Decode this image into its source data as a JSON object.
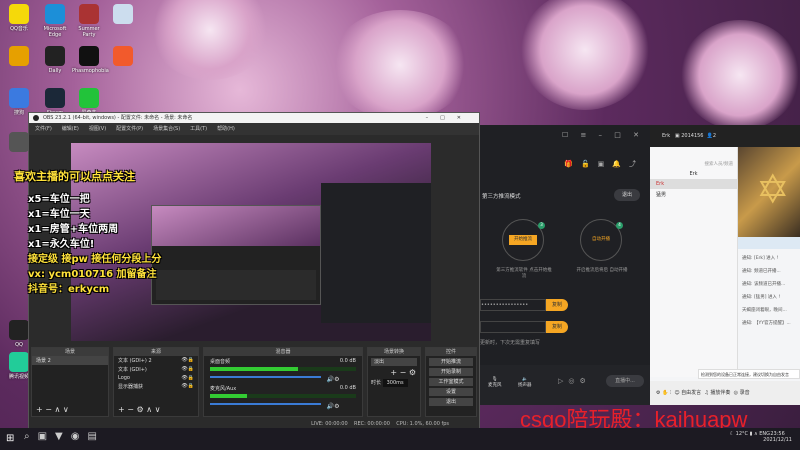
{
  "desktop_icons": [
    {
      "label": "QQ音乐",
      "color": "#f5d90a"
    },
    {
      "label": "Microsoft Edge",
      "color": "#1c8fd8"
    },
    {
      "label": "Summer Party",
      "color": "#a33"
    },
    {
      "label": "",
      "color": "#cde"
    },
    {
      "label": "",
      "color": "#e6a000"
    },
    {
      "label": "Dally",
      "color": "#222"
    },
    {
      "label": "Phasmophobia",
      "color": "#111"
    },
    {
      "label": "",
      "color": "#f25a2c"
    },
    {
      "label": "搜狗",
      "color": "#3b7ae0"
    },
    {
      "label": "Steam",
      "color": "#1b2838"
    },
    {
      "label": "爱奇艺",
      "color": "#22c33a"
    },
    {
      "label": "",
      "color": "#555"
    },
    {
      "label": "QQ",
      "color": "#222"
    },
    {
      "label": "腾讯视频",
      "color": "#2c9"
    }
  ],
  "overlay": {
    "title": "喜欢主播的可以点点关注",
    "lines": [
      "x5=车位一把",
      "x1=车位一天",
      "x1=房管+车位两周",
      "x1=永久车位!",
      "接定级 接pw 接任何分段上分",
      "vx: ycm010716 加留备注",
      "抖音号：erkycm"
    ],
    "watermark": "csgo陪玩殿：kaihuapw"
  },
  "obs": {
    "title": "OBS 23.2.1 (64-bit, windows) - 配置文件: 未命名 - 场景: 未命名",
    "menu": [
      "文件(F)",
      "编辑(E)",
      "视图(V)",
      "配置文件(P)",
      "场景集合(S)",
      "工具(T)",
      "帮助(H)"
    ],
    "docks": {
      "scenes": "场景",
      "sources": "来源",
      "mixer": "混音器",
      "transitions": "场景转换",
      "controls": "控件"
    },
    "scene_items": [
      "场景 2"
    ],
    "source_items": [
      "文本 (GDI+) 2",
      "文本 (GDI+)",
      "Logo",
      "显示器捕获"
    ],
    "mixer": [
      {
        "name": "桌面音频",
        "db": "0.0 dB",
        "level": 0.6
      },
      {
        "name": "麦克风/Aux",
        "db": "0.0 dB",
        "level": 0.25
      }
    ],
    "transition": "淡出",
    "duration_label": "时长",
    "duration": "300ms",
    "controls": [
      "开始推流",
      "开始录制",
      "工作室模式",
      "设置",
      "退出"
    ],
    "status": {
      "live": "LIVE: 00:00:00",
      "rec": "REC: 00:00:00",
      "cpu": "CPU: 1.0%, 60.00 fps"
    }
  },
  "app": {
    "mode": "第三方推流模式",
    "exit": "退出",
    "step3": {
      "btn": "开始推流",
      "desc": "第三方推流软件 点击开始推流"
    },
    "step4": {
      "btn": "自动开播",
      "desc": "开启推流后将后 自动开播"
    },
    "key_mask": "••••••••••••••••",
    "copy": "复制",
    "hint": "更新时，下次无需重复填写",
    "mic": "麦克风",
    "speaker": "扬声器",
    "live": "直播中..."
  },
  "yy": {
    "user": "Erk",
    "room": "2014156",
    "count": "2",
    "search": "搜索人员/频道",
    "channel": "Erk",
    "members": [
      "Erk",
      "猛男"
    ],
    "messages": [
      "通知: [Erk] 进入 !",
      "通知: 频道已开播...",
      "通知: 该频道已开播...",
      "通知: [猛男] 进入 !",
      "天蝎座闭着眼，晚间...",
      "通知: 【YY官方提醒】..."
    ],
    "tip": "检测到您的设备已正常连接，建议切换为自由发言",
    "tools": [
      "自由发言",
      "播放伴奏",
      "录音"
    ]
  },
  "taskbar": {
    "temp": "12°C",
    "lang": "ENG",
    "time": "23:56",
    "date": "2021/12/11"
  }
}
